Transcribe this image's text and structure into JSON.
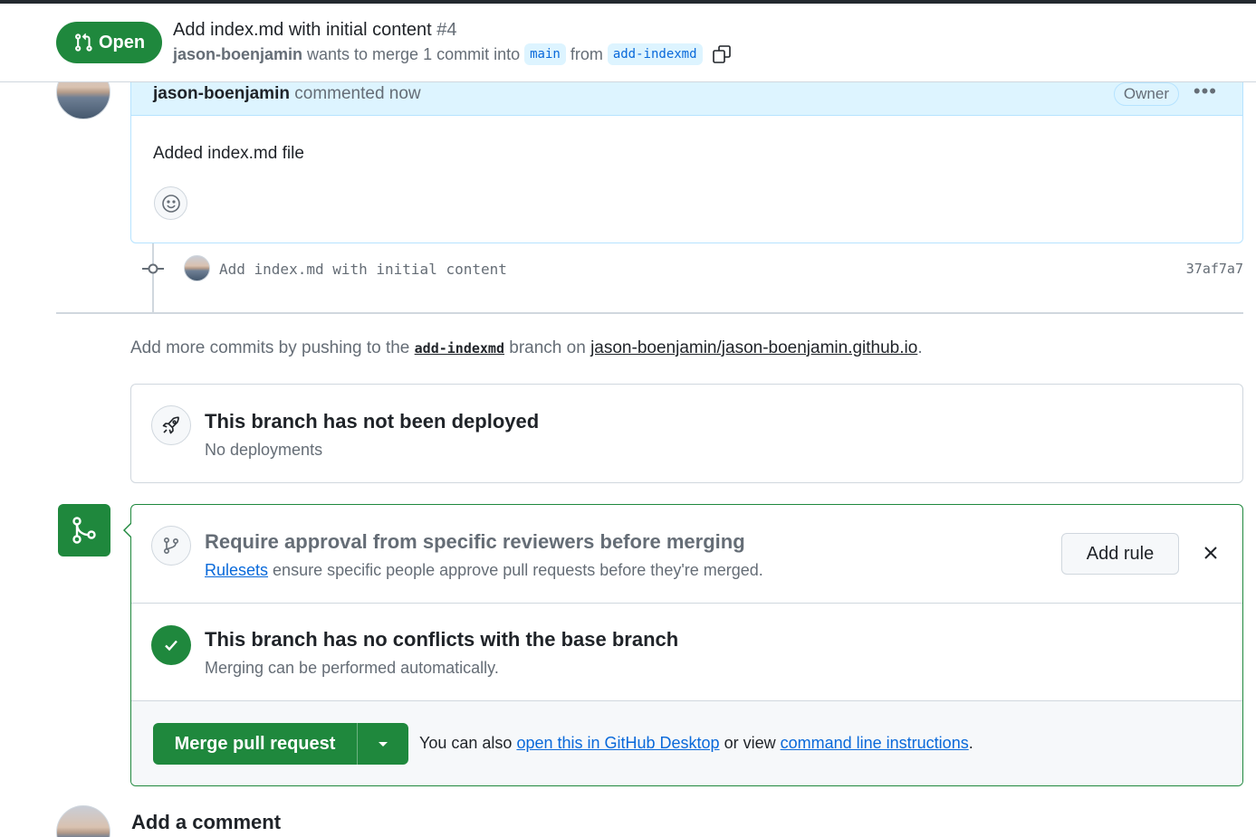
{
  "header": {
    "state": "Open",
    "title": "Add index.md with initial content",
    "number": "#4",
    "author": "jason-boenjamin",
    "meta_text": "wants to merge 1 commit into",
    "base_branch": "main",
    "from_text": "from",
    "head_branch": "add-indexmd"
  },
  "comment": {
    "author": "jason-boenjamin",
    "time": "commented now",
    "role": "Owner",
    "body": "Added index.md file"
  },
  "commit": {
    "message": "Add index.md with initial content",
    "sha": "37af7a7"
  },
  "push_hint": {
    "prefix": "Add more commits by pushing to the",
    "branch": "add-indexmd",
    "middle": "branch on",
    "repo": "jason-boenjamin/jason-boenjamin.github.io",
    "suffix": "."
  },
  "deployment": {
    "title": "This branch has not been deployed",
    "subtitle": "No deployments"
  },
  "ruleset": {
    "title": "Require approval from specific reviewers before merging",
    "link": "Rulesets",
    "text": "ensure specific people approve pull requests before they're merged.",
    "button": "Add rule"
  },
  "conflicts": {
    "title": "This branch has no conflicts with the base branch",
    "subtitle": "Merging can be performed automatically."
  },
  "merge": {
    "button": "Merge pull request",
    "hint_prefix": "You can also",
    "desktop_link": "open this in GitHub Desktop",
    "hint_middle": "or view",
    "cli_link": "command line instructions",
    "hint_suffix": "."
  },
  "add_comment": {
    "title": "Add a comment"
  },
  "colors": {
    "green": "#1f883d",
    "link": "#0969da",
    "comment_header": "#ddf4ff"
  }
}
